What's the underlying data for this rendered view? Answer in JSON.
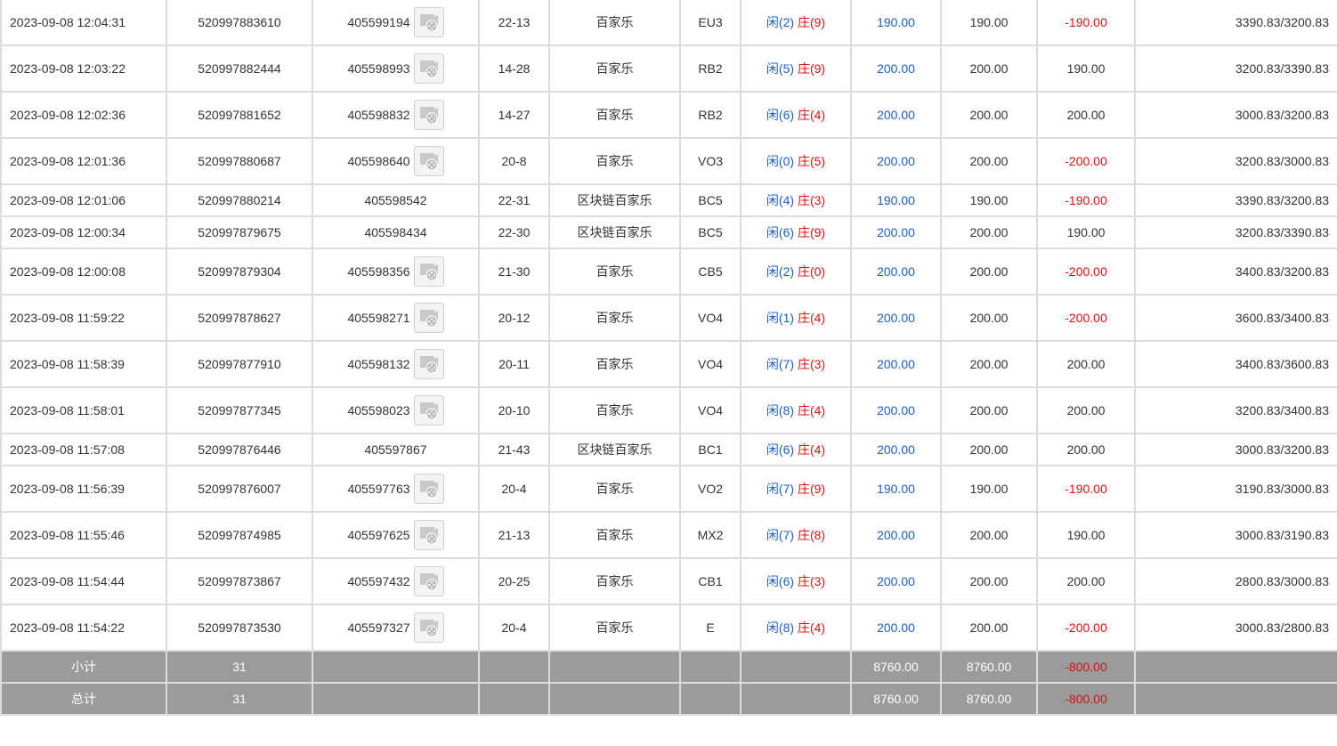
{
  "rows": [
    {
      "time": "2023-09-08 12:04:31",
      "bet_id": "520997883610",
      "round": "405599194",
      "video": true,
      "table": "22-13",
      "game": "百家乐",
      "code": "EU3",
      "player_label": "闲",
      "player_score": "(2)",
      "banker_label": "庄",
      "banker_score": "(9)",
      "bet": "190.00",
      "bet_color": "blue",
      "valid": "190.00",
      "win": "-190.00",
      "win_color": "red",
      "balance": "3390.83/3200.83",
      "size": "tall"
    },
    {
      "time": "2023-09-08 12:03:22",
      "bet_id": "520997882444",
      "round": "405598993",
      "video": true,
      "table": "14-28",
      "game": "百家乐",
      "code": "RB2",
      "player_label": "闲",
      "player_score": "(5)",
      "banker_label": "庄",
      "banker_score": "(9)",
      "bet": "200.00",
      "bet_color": "blue",
      "valid": "200.00",
      "win": "190.00",
      "win_color": "",
      "balance": "3200.83/3390.83",
      "size": "tall"
    },
    {
      "time": "2023-09-08 12:02:36",
      "bet_id": "520997881652",
      "round": "405598832",
      "video": true,
      "table": "14-27",
      "game": "百家乐",
      "code": "RB2",
      "player_label": "闲",
      "player_score": "(6)",
      "banker_label": "庄",
      "banker_score": "(4)",
      "bet": "200.00",
      "bet_color": "blue",
      "valid": "200.00",
      "win": "200.00",
      "win_color": "",
      "balance": "3000.83/3200.83",
      "size": "tall"
    },
    {
      "time": "2023-09-08 12:01:36",
      "bet_id": "520997880687",
      "round": "405598640",
      "video": true,
      "table": "20-8",
      "game": "百家乐",
      "code": "VO3",
      "player_label": "闲",
      "player_score": "(0)",
      "banker_label": "庄",
      "banker_score": "(5)",
      "bet": "200.00",
      "bet_color": "blue",
      "valid": "200.00",
      "win": "-200.00",
      "win_color": "red",
      "balance": "3200.83/3000.83",
      "size": "tall"
    },
    {
      "time": "2023-09-08 12:01:06",
      "bet_id": "520997880214",
      "round": "405598542",
      "video": false,
      "table": "22-31",
      "game": "区块链百家乐",
      "code": "BC5",
      "player_label": "闲",
      "player_score": "(4)",
      "banker_label": "庄",
      "banker_score": "(3)",
      "bet": "190.00",
      "bet_color": "blue",
      "valid": "190.00",
      "win": "-190.00",
      "win_color": "red",
      "balance": "3390.83/3200.83",
      "size": "short"
    },
    {
      "time": "2023-09-08 12:00:34",
      "bet_id": "520997879675",
      "round": "405598434",
      "video": false,
      "table": "22-30",
      "game": "区块链百家乐",
      "code": "BC5",
      "player_label": "闲",
      "player_score": "(6)",
      "banker_label": "庄",
      "banker_score": "(9)",
      "bet": "200.00",
      "bet_color": "blue",
      "valid": "200.00",
      "win": "190.00",
      "win_color": "",
      "balance": "3200.83/3390.83",
      "size": "short"
    },
    {
      "time": "2023-09-08 12:00:08",
      "bet_id": "520997879304",
      "round": "405598356",
      "video": true,
      "table": "21-30",
      "game": "百家乐",
      "code": "CB5",
      "player_label": "闲",
      "player_score": "(2)",
      "banker_label": "庄",
      "banker_score": "(0)",
      "bet": "200.00",
      "bet_color": "blue",
      "valid": "200.00",
      "win": "-200.00",
      "win_color": "red",
      "balance": "3400.83/3200.83",
      "size": "tall"
    },
    {
      "time": "2023-09-08 11:59:22",
      "bet_id": "520997878627",
      "round": "405598271",
      "video": true,
      "table": "20-12",
      "game": "百家乐",
      "code": "VO4",
      "player_label": "闲",
      "player_score": "(1)",
      "banker_label": "庄",
      "banker_score": "(4)",
      "bet": "200.00",
      "bet_color": "blue",
      "valid": "200.00",
      "win": "-200.00",
      "win_color": "red",
      "balance": "3600.83/3400.83",
      "size": "tall"
    },
    {
      "time": "2023-09-08 11:58:39",
      "bet_id": "520997877910",
      "round": "405598132",
      "video": true,
      "table": "20-11",
      "game": "百家乐",
      "code": "VO4",
      "player_label": "闲",
      "player_score": "(7)",
      "banker_label": "庄",
      "banker_score": "(3)",
      "bet": "200.00",
      "bet_color": "blue",
      "valid": "200.00",
      "win": "200.00",
      "win_color": "",
      "balance": "3400.83/3600.83",
      "size": "tall"
    },
    {
      "time": "2023-09-08 11:58:01",
      "bet_id": "520997877345",
      "round": "405598023",
      "video": true,
      "table": "20-10",
      "game": "百家乐",
      "code": "VO4",
      "player_label": "闲",
      "player_score": "(8)",
      "banker_label": "庄",
      "banker_score": "(4)",
      "bet": "200.00",
      "bet_color": "blue",
      "valid": "200.00",
      "win": "200.00",
      "win_color": "",
      "balance": "3200.83/3400.83",
      "size": "tall"
    },
    {
      "time": "2023-09-08 11:57:08",
      "bet_id": "520997876446",
      "round": "405597867",
      "video": false,
      "table": "21-43",
      "game": "区块链百家乐",
      "code": "BC1",
      "player_label": "闲",
      "player_score": "(6)",
      "banker_label": "庄",
      "banker_score": "(4)",
      "bet": "200.00",
      "bet_color": "blue",
      "valid": "200.00",
      "win": "200.00",
      "win_color": "",
      "balance": "3000.83/3200.83",
      "size": "short"
    },
    {
      "time": "2023-09-08 11:56:39",
      "bet_id": "520997876007",
      "round": "405597763",
      "video": true,
      "table": "20-4",
      "game": "百家乐",
      "code": "VO2",
      "player_label": "闲",
      "player_score": "(7)",
      "banker_label": "庄",
      "banker_score": "(9)",
      "bet": "190.00",
      "bet_color": "blue",
      "valid": "190.00",
      "win": "-190.00",
      "win_color": "red",
      "balance": "3190.83/3000.83",
      "size": "tall"
    },
    {
      "time": "2023-09-08 11:55:46",
      "bet_id": "520997874985",
      "round": "405597625",
      "video": true,
      "table": "21-13",
      "game": "百家乐",
      "code": "MX2",
      "player_label": "闲",
      "player_score": "(7)",
      "banker_label": "庄",
      "banker_score": "(8)",
      "bet": "200.00",
      "bet_color": "blue",
      "valid": "200.00",
      "win": "190.00",
      "win_color": "",
      "balance": "3000.83/3190.83",
      "size": "tall"
    },
    {
      "time": "2023-09-08 11:54:44",
      "bet_id": "520997873867",
      "round": "405597432",
      "video": true,
      "table": "20-25",
      "game": "百家乐",
      "code": "CB1",
      "player_label": "闲",
      "player_score": "(6)",
      "banker_label": "庄",
      "banker_score": "(3)",
      "bet": "200.00",
      "bet_color": "blue",
      "valid": "200.00",
      "win": "200.00",
      "win_color": "",
      "balance": "2800.83/3000.83",
      "size": "tall"
    },
    {
      "time": "2023-09-08 11:54:22",
      "bet_id": "520997873530",
      "round": "405597327",
      "video": true,
      "table": "20-4",
      "game": "百家乐",
      "code": "E",
      "player_label": "闲",
      "player_score": "(8)",
      "banker_label": "庄",
      "banker_score": "(4)",
      "bet": "200.00",
      "bet_color": "blue",
      "valid": "200.00",
      "win": "-200.00",
      "win_color": "red",
      "balance": "3000.83/2800.83",
      "size": "tall"
    }
  ],
  "subtotal": {
    "label": "小计",
    "count": "31",
    "bet": "8760.00",
    "valid": "8760.00",
    "win": "-800.00"
  },
  "total": {
    "label": "总计",
    "count": "31",
    "bet": "8760.00",
    "valid": "8760.00",
    "win": "-800.00"
  },
  "icons": {
    "video": "video-replay-icon"
  },
  "colors": {
    "blue": "#1a5fc8",
    "red": "#e30f0f",
    "summary_bg": "#9b9b9b",
    "grid": "#dcdcdc"
  }
}
